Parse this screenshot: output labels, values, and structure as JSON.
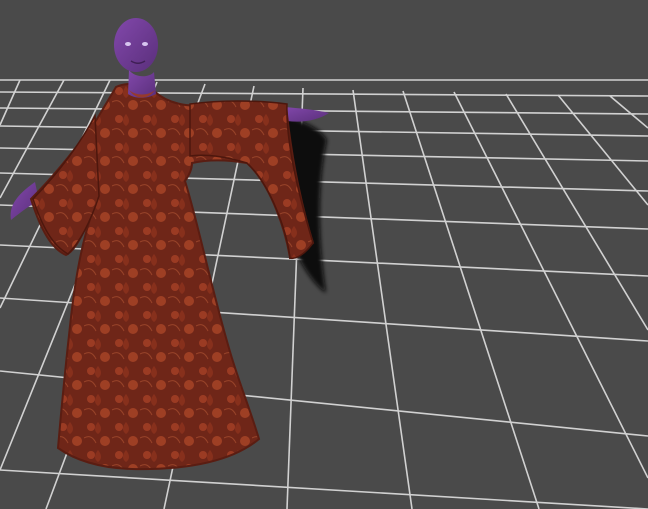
{
  "viewport": {
    "background": "#4a4a4a"
  },
  "grid": {
    "line_color": "#d9d9d9",
    "background": "#4a4a4a"
  },
  "figure": {
    "skin_color": "#6f3a93",
    "dress_color": "#7a2a1b",
    "dress_pattern_color": "#b24a2a",
    "shadow_color": "#111111"
  }
}
